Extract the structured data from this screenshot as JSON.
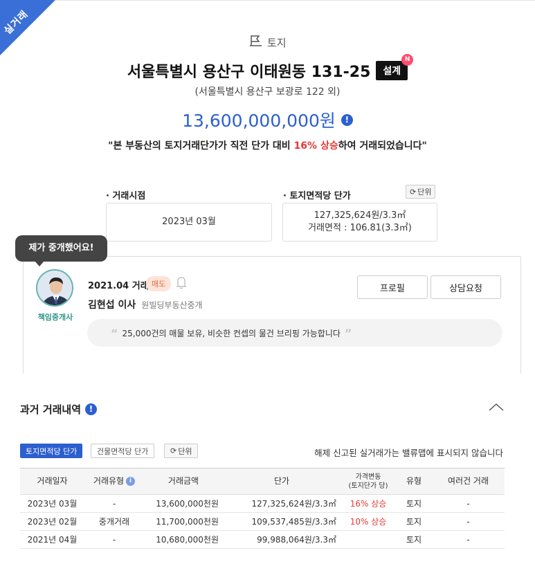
{
  "ribbon": {
    "label": "실거래",
    "color": "#3b6fd8"
  },
  "property": {
    "category": "토지",
    "address": "서울특별시 용산구 이태원동 131-25",
    "design_badge": "설계",
    "new_badge": "N",
    "road_address": "(서울특별시 용산구 보광로 122 외)",
    "price": "13,600,000,000원",
    "summary": {
      "before": "\"본 부동산의 토지거래단가가 직전 단가 대비 ",
      "highlight": "16% 상승",
      "after": "하여 거래되었습니다\""
    }
  },
  "fields": {
    "trade_date_label": "· 거래시점",
    "trade_date_value": "2023년 03월",
    "unit_price_label": "· 토지면적당 단가",
    "unit_price_value": "127,325,624원/3.3㎡",
    "trade_area_value": "거래면적 : 106.81(3.3㎡)",
    "unit_toggle": "단위"
  },
  "agent": {
    "tooltip": "제가 중개했어요!",
    "role": "책임중개사",
    "trade_date": "2021.04 거래",
    "trade_type": "매도",
    "name": "김현섭 이사",
    "office": "원빌딩부동산중개",
    "profile_button": "프로필",
    "consult_button": "상담요청",
    "quote": "25,000건의 매물 보유, 비슷한 컨셉의 물건 브리핑 가능합니다"
  },
  "history": {
    "title": "과거 거래내역",
    "tabs": {
      "land": "토지면적당 단가",
      "building": "건물면적당 단가",
      "unit": "단위"
    },
    "cancel_note": "해제 신고된 실거래가는 밸류맵에 표시되지 않습니다",
    "headers": {
      "date": "거래일자",
      "type": "거래유형",
      "amount": "거래금액",
      "unit_price": "단가",
      "change_line1": "가격변동",
      "change_line2": "(토지단가 당)",
      "category": "유형",
      "multi": "여러건 거래"
    },
    "rows": [
      {
        "date": "2023년 03월",
        "type": "-",
        "amount": "13,600,000천원",
        "unit_price": "127,325,624원/3.3㎡",
        "change": "16% 상승",
        "category": "토지",
        "multi": "-"
      },
      {
        "date": "2023년 02월",
        "type": "중개거래",
        "amount": "11,700,000천원",
        "unit_price": "109,537,485원/3.3㎡",
        "change": "10% 상승",
        "category": "토지",
        "multi": "-"
      },
      {
        "date": "2021년 04월",
        "type": "-",
        "amount": "10,680,000천원",
        "unit_price": "99,988,064원/3.3㎡",
        "change": "",
        "category": "토지",
        "multi": "-"
      }
    ]
  },
  "colors": {
    "primary": "#2c5fcf",
    "up": "#e53935",
    "agent_accent": "#2e9488",
    "sale_badge": "#e96b3f"
  }
}
